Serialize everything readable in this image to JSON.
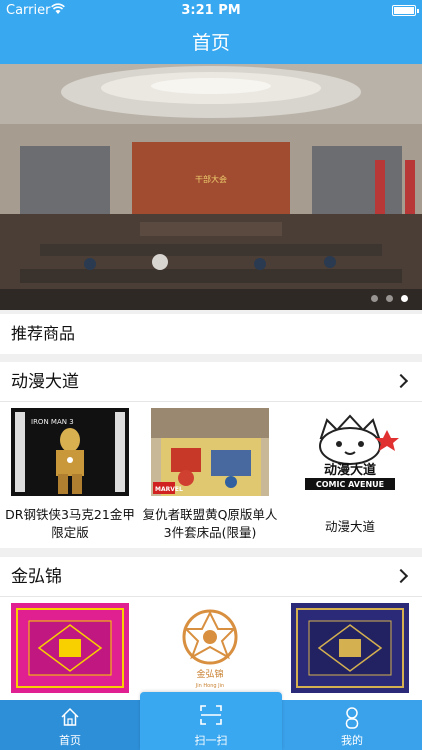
{
  "status_bar": {
    "carrier": "Carrier",
    "time": "3:21 PM"
  },
  "nav": {
    "title": "首页"
  },
  "banner": {
    "slide_count": 3,
    "active_index": 2,
    "stage_sign": "干部大会"
  },
  "recommend": {
    "title": "推荐商品"
  },
  "categories": [
    {
      "title": "动漫大道",
      "items": [
        {
          "name": "DR钢铁侠3马克21金甲限定版",
          "thumb_text": "IRON MAN 3"
        },
        {
          "name": "复仇者联盟黄Q原版单人3件套床品(限量)",
          "thumb_text": "MARVEL"
        },
        {
          "name": "动漫大道",
          "thumb_text_cn": "动漫大道",
          "thumb_text_en": "COMIC AVENUE"
        }
      ]
    },
    {
      "title": "金弘锦",
      "items": [
        {
          "name": ""
        },
        {
          "name": "",
          "thumb_text_cn": "金弘锦",
          "thumb_text_en": "Jin Hong Jin"
        },
        {
          "name": ""
        }
      ]
    }
  ],
  "tabbar": {
    "tabs": [
      {
        "label": "首页",
        "icon": "home-icon"
      },
      {
        "label": "扫一扫",
        "icon": "scan-icon"
      },
      {
        "label": "我的",
        "icon": "person-icon"
      }
    ]
  },
  "colors": {
    "primary": "#38a8f0",
    "tabbar": "#3aa2ea"
  }
}
